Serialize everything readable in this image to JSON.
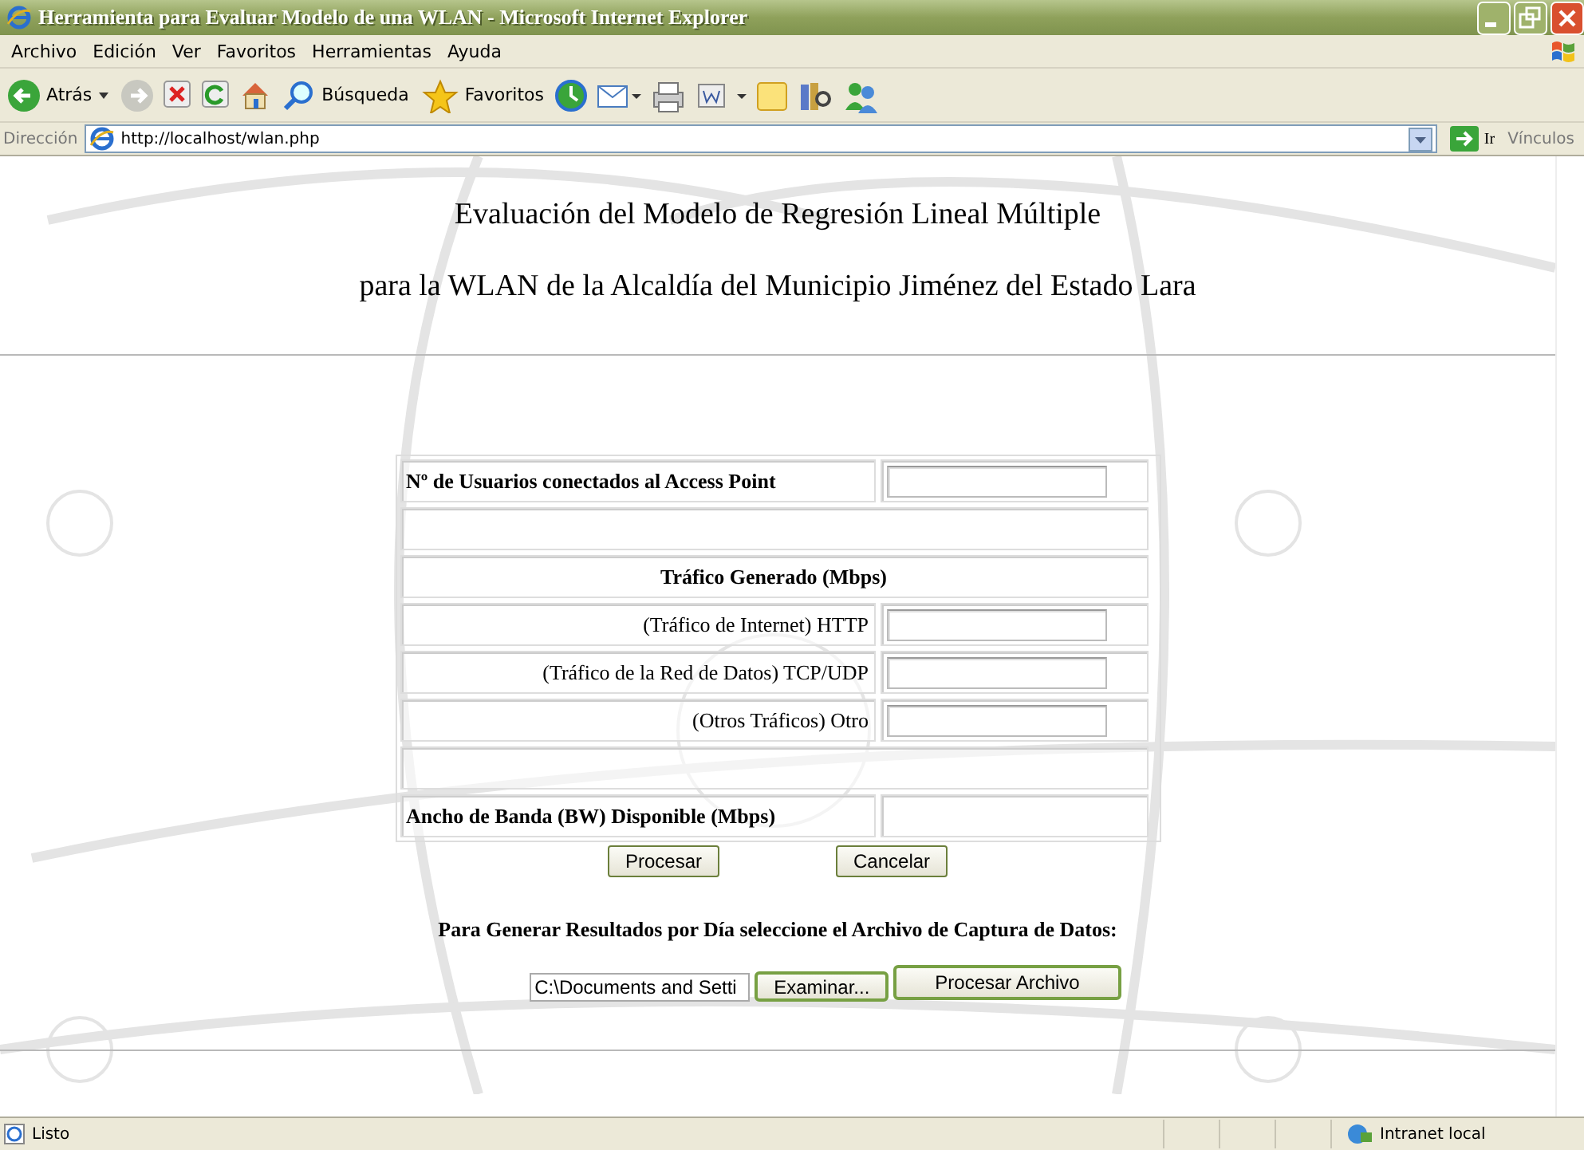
{
  "window": {
    "title": "Herramienta para Evaluar Modelo de una WLAN - Microsoft Internet Explorer"
  },
  "menu": [
    "Archivo",
    "Edición",
    "Ver",
    "Favoritos",
    "Herramientas",
    "Ayuda"
  ],
  "toolbar": [
    {
      "kind": "back",
      "label": "Atrás"
    },
    {
      "kind": "forward"
    },
    {
      "kind": "stop"
    },
    {
      "kind": "refresh"
    },
    {
      "kind": "home"
    },
    {
      "kind": "search",
      "label": "Búsqueda"
    },
    {
      "kind": "favorites",
      "label": "Favoritos"
    },
    {
      "kind": "history"
    },
    {
      "kind": "mail"
    },
    {
      "kind": "print"
    },
    {
      "kind": "edit"
    },
    {
      "kind": "folder"
    },
    {
      "kind": "research"
    },
    {
      "kind": "messenger"
    }
  ],
  "address_bar": {
    "label": "Dirección",
    "value": "http://localhost/wlan.php",
    "go": "Ir",
    "links": "Vínculos"
  },
  "page": {
    "heading": [
      "Evaluación del Modelo de Regresión Lineal Múltiple",
      "para la WLAN de la Alcaldía del Municipio Jiménez del Estado Lara"
    ],
    "form_rows": [
      {
        "kind": "count",
        "label": "Nº de Usuarios conectados al Access Point"
      },
      {
        "kind": "spacer"
      },
      {
        "kind": "section",
        "label": "Tráfico Generado (Mbps)"
      },
      {
        "kind": "traffic",
        "label": "(Tráfico de Internet) HTTP"
      },
      {
        "kind": "traffic",
        "label": "(Tráfico de la Red de Datos) TCP/UDP"
      },
      {
        "kind": "traffic",
        "label": "(Otros Tráficos) Otro"
      },
      {
        "kind": "spacer"
      },
      {
        "kind": "result",
        "label": "Ancho de Banda (BW) Disponible (Mbps)"
      }
    ],
    "buttons": [
      "Procesar",
      "Cancelar"
    ],
    "file_prompt": "Para Generar Resultados por Día seleccione el Archivo de Captura de Datos:",
    "file_value": "C:\\Documents and Setti",
    "browse": "Examinar...",
    "process_file": "Procesar Archivo"
  },
  "status_bar": {
    "text": "Listo",
    "zone": "Intranet local"
  }
}
